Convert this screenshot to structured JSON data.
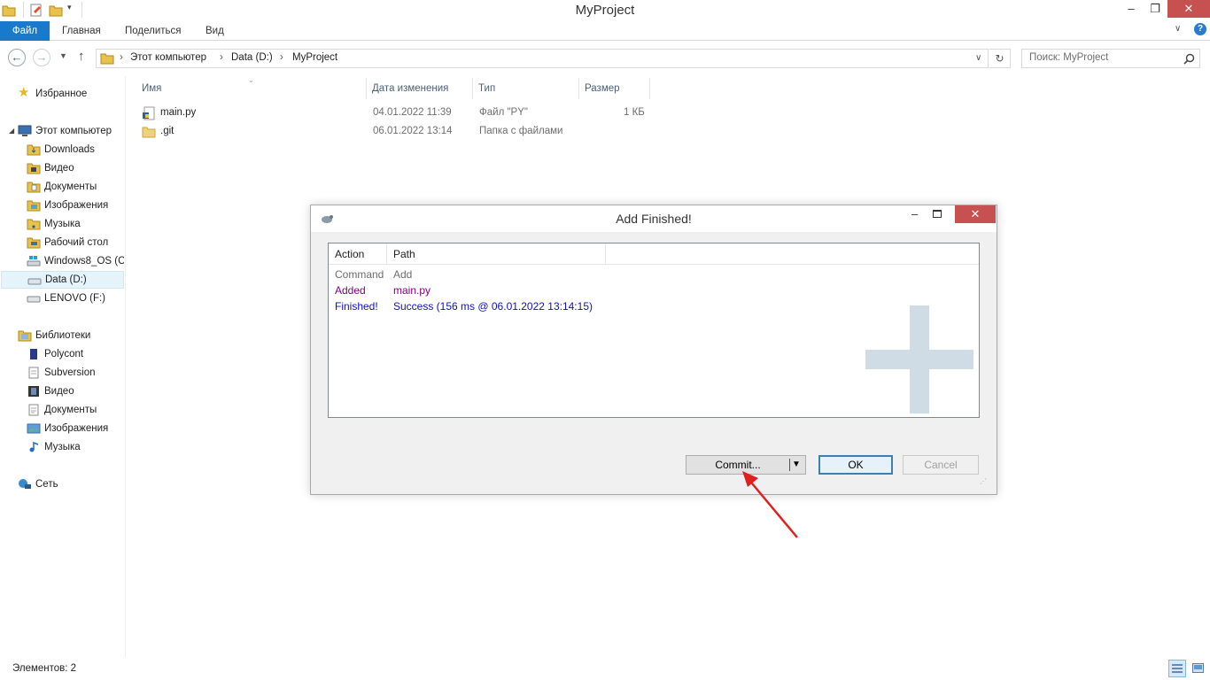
{
  "window": {
    "title": "MyProject",
    "minimize": "–",
    "maximize": "❐",
    "close": "✕",
    "help": "?"
  },
  "ribbon": {
    "tabs": [
      "Файл",
      "Главная",
      "Поделиться",
      "Вид"
    ]
  },
  "address": {
    "segments": [
      "Этот компьютер",
      "Data (D:)",
      "MyProject"
    ],
    "search_placeholder": "Поиск: MyProject"
  },
  "nav": {
    "favorites": "Избранное",
    "computer": "Этот компьютер",
    "computer_items": [
      "Downloads",
      "Видео",
      "Документы",
      "Изображения",
      "Музыка",
      "Рабочий стол",
      "Windows8_OS (C",
      "Data (D:)",
      "LENOVO (F:)"
    ],
    "libraries": "Библиотеки",
    "library_items": [
      "Polycont",
      "Subversion",
      "Видео",
      "Документы",
      "Изображения",
      "Музыка"
    ],
    "network": "Сеть"
  },
  "files": {
    "columns": [
      "Имя",
      "Дата изменения",
      "Тип",
      "Размер"
    ],
    "rows": [
      {
        "name": "main.py",
        "date": "04.01.2022 11:39",
        "type": "Файл \"PY\"",
        "size": "1 КБ"
      },
      {
        "name": ".git",
        "date": "06.01.2022 13:14",
        "type": "Папка с файлами",
        "size": ""
      }
    ]
  },
  "status": {
    "items_count": "Элементов: 2"
  },
  "dialog": {
    "title": "Add Finished!",
    "columns": [
      "Action",
      "Path"
    ],
    "rows": [
      {
        "action": "Command",
        "path": "Add",
        "color": "#6d6d6d"
      },
      {
        "action": "Added",
        "path": "main.py",
        "color": "#800080"
      },
      {
        "action": "Finished!",
        "path": "Success (156 ms @ 06.01.2022 13:14:15)",
        "color": "#1010c0"
      }
    ],
    "commit_label": "Commit...",
    "ok_label": "OK",
    "cancel_label": "Cancel"
  },
  "colors": {
    "file_tab": "#1979ca",
    "dialog_close": "#c75050",
    "annotation_arrow": "#e02020"
  }
}
